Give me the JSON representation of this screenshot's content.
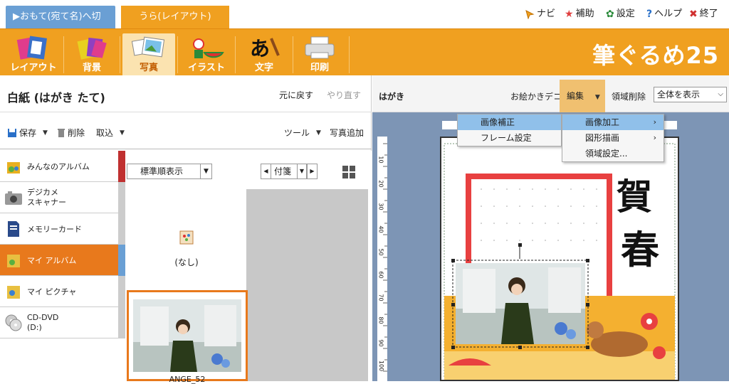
{
  "top_tabs": {
    "omote": "▶おもて(宛て名)へ切替",
    "ura": "うら(レイアウト)"
  },
  "top_menu": [
    {
      "label": "ナビ",
      "icon": "cursor-icon"
    },
    {
      "label": "補助",
      "icon": "star-icon"
    },
    {
      "label": "設定",
      "icon": "gear-icon"
    },
    {
      "label": "ヘルプ",
      "icon": "help-icon"
    },
    {
      "label": "終了",
      "icon": "close-icon"
    }
  ],
  "tools": [
    {
      "label": "レイアウト",
      "icon": "layout-icon"
    },
    {
      "label": "背景",
      "icon": "background-icon"
    },
    {
      "label": "写真",
      "icon": "photo-icon",
      "active": true
    },
    {
      "label": "イラスト",
      "icon": "illustration-icon"
    },
    {
      "label": "文字",
      "icon": "text-icon"
    },
    {
      "label": "印刷",
      "icon": "printer-icon"
    }
  ],
  "brand": "筆ぐるめ25",
  "doc": {
    "title": "白紙 (はがき たて)",
    "undo": "元に戻す",
    "redo": "やり直す"
  },
  "filebar": {
    "save": "保存",
    "delete": "削除",
    "import": "取込",
    "tools": "ツール",
    "add_photo": "写真追加"
  },
  "sidebar": [
    {
      "label": "みんなのアルバム",
      "icon": "album-icon"
    },
    {
      "label": "デジカメ\nスキャナー",
      "icon": "camera-icon"
    },
    {
      "label": "メモリーカード",
      "icon": "memory-card-icon"
    },
    {
      "label": "マイ アルバム",
      "icon": "my-album-icon",
      "active": true
    },
    {
      "label": "マイ ピクチャ",
      "icon": "my-picture-icon"
    },
    {
      "label": "CD-DVD\n(D:)",
      "icon": "disc-icon"
    }
  ],
  "photo_area": {
    "sort": "標準順表示",
    "tag": "付箋",
    "none_label": "(なし)",
    "photo_label": "ANGE_52"
  },
  "right_bar": {
    "hagaki": "はがき",
    "deco": "お絵かきデコ",
    "edit": "編集",
    "clear": "領域削除",
    "zoom": "全体を表示"
  },
  "ruler_marks": [
    "10",
    "20",
    "30",
    "40",
    "50",
    "60",
    "70",
    "80",
    "90",
    "100"
  ],
  "greeting": [
    "賀",
    "春"
  ],
  "menu1": [
    {
      "label": "画像補正",
      "highlight": true
    },
    {
      "label": "フレーム設定"
    }
  ],
  "menu2": [
    {
      "label": "画像加工",
      "highlight": true,
      "arrow": "›"
    },
    {
      "label": "図形描画",
      "arrow": "›"
    },
    {
      "label": "領域設定..."
    }
  ],
  "colors": {
    "accent_orange": "#f0a020",
    "active_orange": "#e8791c",
    "tab_blue": "#6a9fd4",
    "canvas_bg": "#7d95b5",
    "menu_highlight": "#90c0ea"
  }
}
